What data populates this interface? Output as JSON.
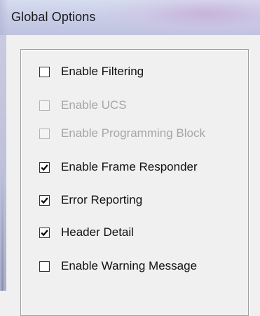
{
  "window": {
    "title": "Global Options"
  },
  "options": [
    {
      "label": "Enable Filtering",
      "checked": false,
      "enabled": true
    },
    {
      "label": "Enable UCS",
      "checked": false,
      "enabled": false
    },
    {
      "label": "Enable Programming Block",
      "checked": false,
      "enabled": false
    },
    {
      "label": "Enable Frame Responder",
      "checked": true,
      "enabled": true
    },
    {
      "label": "Error Reporting",
      "checked": true,
      "enabled": true
    },
    {
      "label": "Header Detail",
      "checked": true,
      "enabled": true
    },
    {
      "label": "Enable Warning Message",
      "checked": false,
      "enabled": true
    }
  ],
  "colors": {
    "text": "#111111",
    "disabled_text": "#a6a6a6",
    "dialog_background": "#f0f0f0",
    "titlebar": "#c9cee8"
  }
}
